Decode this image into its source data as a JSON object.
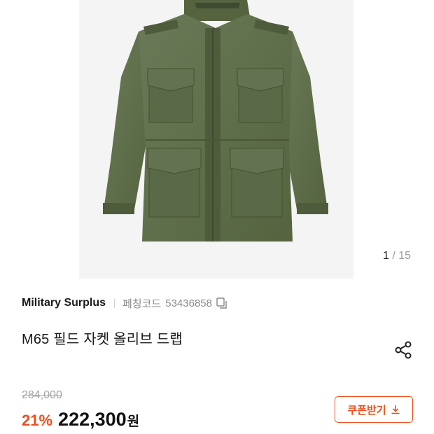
{
  "gallery": {
    "image_alt": "M65 field jacket olive drab",
    "current": "1",
    "separator": "/",
    "total": "15"
  },
  "product": {
    "brand": "Military Surplus",
    "code_label": "페칭코드",
    "code_value": "53436858",
    "title": "M65 필드 자켓 올리브 드랩"
  },
  "pricing": {
    "original": "284,000",
    "discount": "21%",
    "price": "222,300",
    "currency": "원"
  },
  "coupon": {
    "label": "쿠폰받기"
  },
  "icons": {
    "copy": "copy-icon",
    "share": "share-icon",
    "download": "download-icon"
  },
  "colors": {
    "accent": "#f04e1c",
    "jacket": "#5f6e4e"
  }
}
